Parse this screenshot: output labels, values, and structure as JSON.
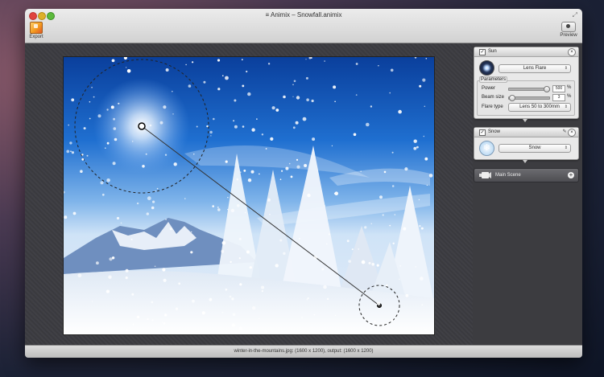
{
  "window": {
    "title": "≡  Animix – Snowfall.animix"
  },
  "toolbar": {
    "export_label": "Export",
    "preview_label": "Preview"
  },
  "panels": {
    "sun": {
      "title": "Sun",
      "effect": "Lens Flare",
      "parameters_label": "Parameters",
      "power_label": "Power",
      "power_value": "500",
      "power_unit": "%",
      "power_level": 0.92,
      "beam_label": "Beam size",
      "beam_value": "3",
      "beam_unit": "%",
      "beam_level": 0.05,
      "flare_label": "Flare type",
      "flare_value": "Lens 50 to 300mm"
    },
    "snow": {
      "title": "Snow",
      "effect": "Snow"
    },
    "scene": {
      "title": "Main Scene"
    }
  },
  "status": {
    "text": "winter-in-the-mountains.jpg: (1600 x 1200), output: (1600 x 1200)"
  },
  "icons": {
    "export": "export-icon",
    "preview": "eye-icon",
    "sun_effect": "lens-flare-icon",
    "snow_effect": "snowflake-icon",
    "scene": "camera-icon",
    "close": "close-icon",
    "add": "plus-icon"
  }
}
